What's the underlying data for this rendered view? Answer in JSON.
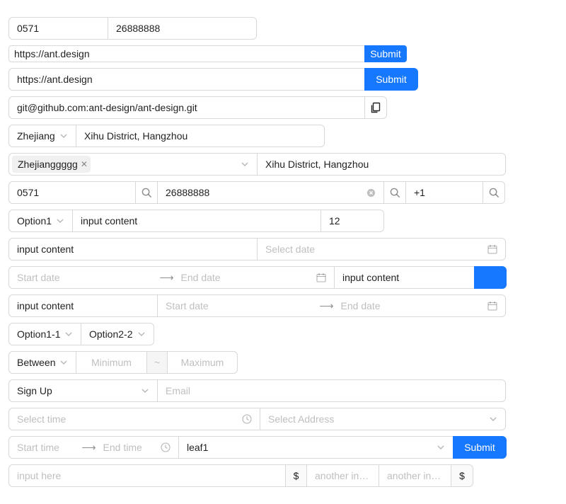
{
  "row1": {
    "area_code": "0571",
    "phone": "26888888"
  },
  "row2": {
    "url": "https://ant.design",
    "submit": "Submit"
  },
  "row3": {
    "url": "https://ant.design",
    "submit": "Submit"
  },
  "row4": {
    "git_url": "git@github.com:ant-design/ant-design.git",
    "copy_icon": "copy-icon"
  },
  "row5": {
    "province": "Zhejiang",
    "address": "Xihu District, Hangzhou"
  },
  "row6": {
    "tag": "Zhejianggggg",
    "address": "Xihu District, Hangzhou"
  },
  "row7": {
    "area_code": "0571",
    "phone": "26888888",
    "country_code": "+1"
  },
  "row8": {
    "option": "Option1",
    "content": "input content",
    "number": "12"
  },
  "row9": {
    "content": "input content",
    "date_placeholder": "Select date"
  },
  "row10": {
    "start_placeholder": "Start date",
    "end_placeholder": "End date",
    "content": "input content",
    "button_label": "  "
  },
  "row11": {
    "content": "input content",
    "start_placeholder": "Start date",
    "end_placeholder": "End date"
  },
  "row12": {
    "option1": "Option1-1",
    "option2": "Option2-2"
  },
  "row13": {
    "compare": "Between",
    "min_placeholder": "Minimum",
    "tilde": "~",
    "max_placeholder": "Maximum"
  },
  "row14": {
    "select": "Sign Up",
    "email_placeholder": "Email"
  },
  "row15": {
    "time_placeholder": "Select time",
    "address_placeholder": "Select Address"
  },
  "row16": {
    "start_time_placeholder": "Start time",
    "end_time_placeholder": "End time",
    "tree_value": "leaf1",
    "submit": "Submit"
  },
  "row17": {
    "input_placeholder": "input here",
    "currency1": "$",
    "another1_placeholder": "another input",
    "another2_placeholder": "another input",
    "currency2": "$"
  },
  "colors": {
    "primary": "#1677ff",
    "border": "#d9d9d9",
    "placeholder": "#bfbfbf"
  }
}
